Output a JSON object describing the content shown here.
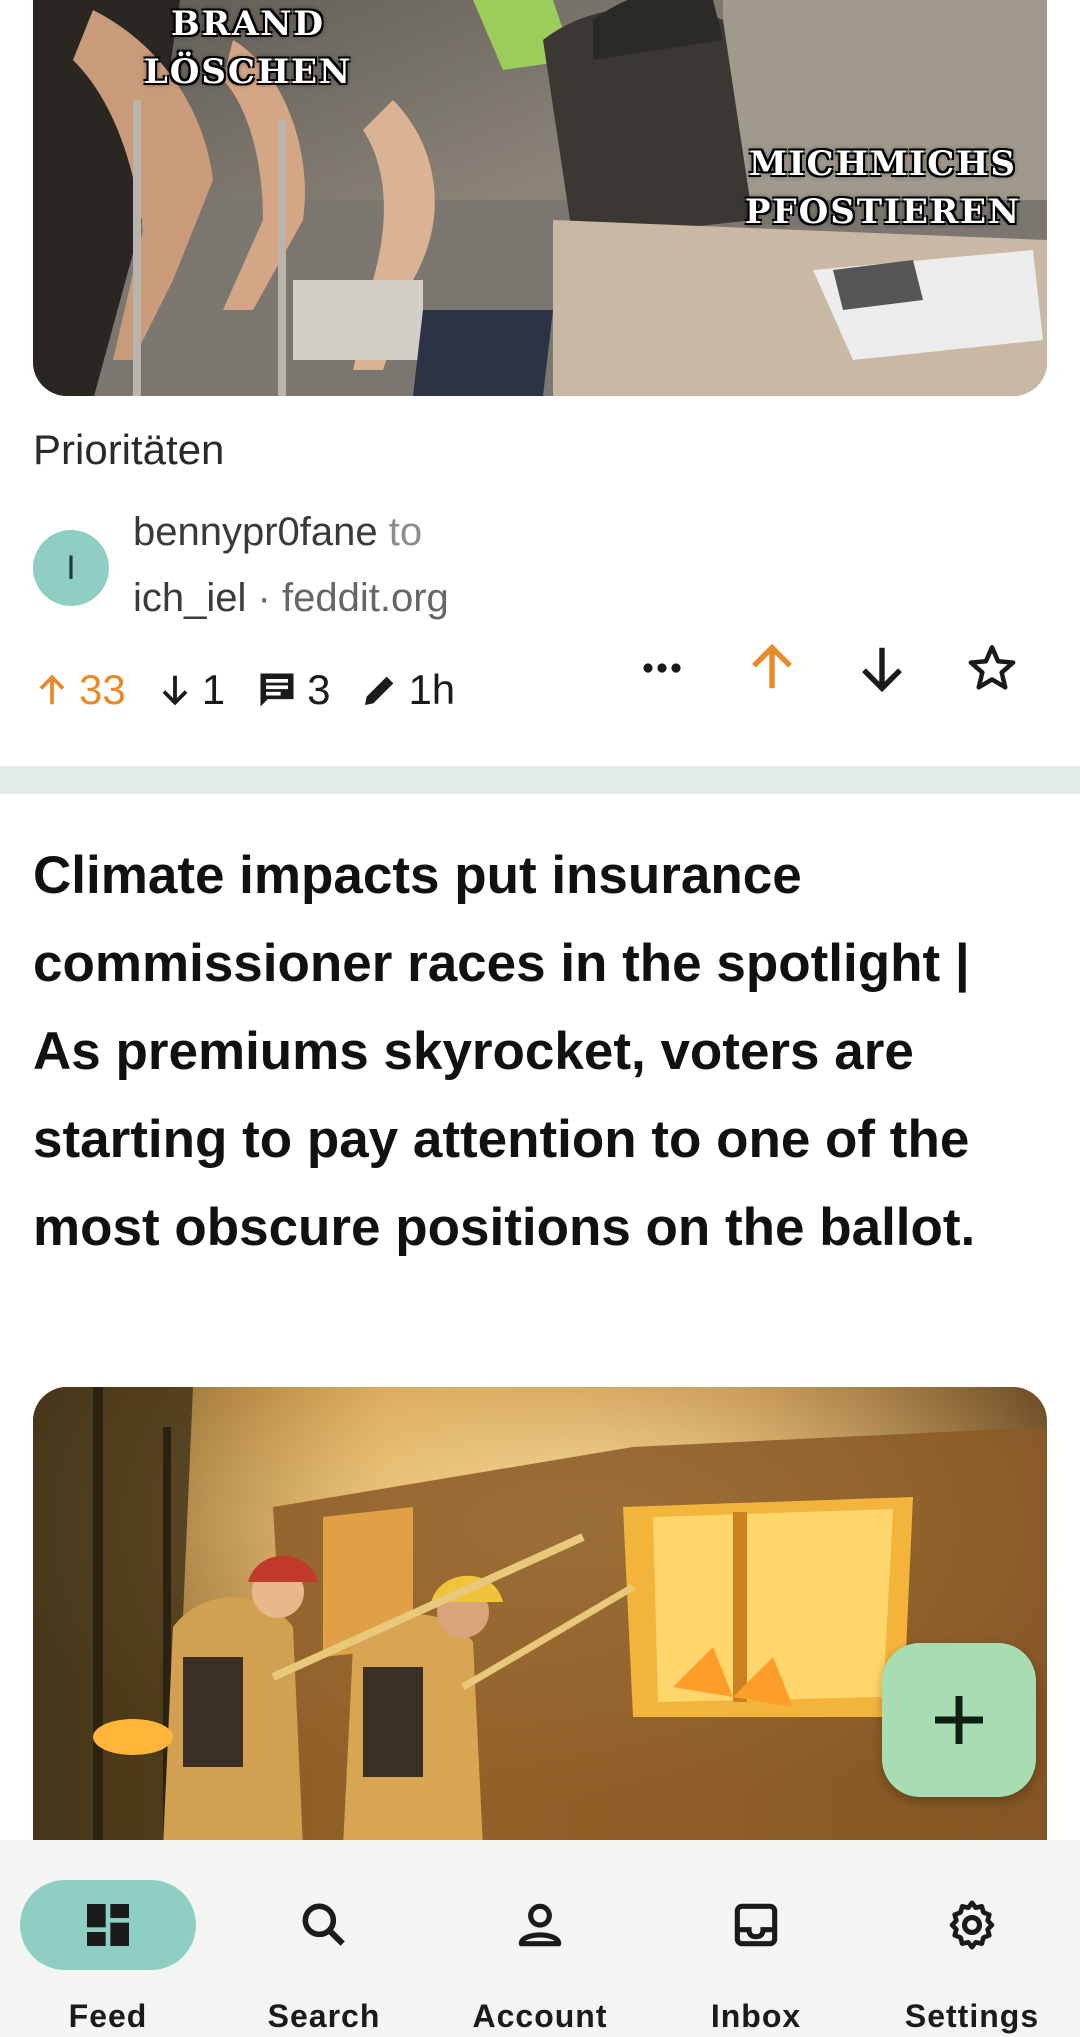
{
  "post1": {
    "image_overlay_left": [
      "BRAND",
      "LÖSCHEN"
    ],
    "image_overlay_right": [
      "MICHMICHS",
      "PFOSTIEREN"
    ],
    "title": "Prioritäten",
    "community_avatar_letter": "I",
    "author": "bennypr0fane",
    "to_label": "to",
    "community": "ich_iel",
    "separator": "·",
    "instance": "feddit.org",
    "upvotes": "33",
    "downvotes": "1",
    "comments": "3",
    "age": "1h",
    "icons": [
      "arrow-up-icon",
      "arrow-down-icon",
      "comment-icon",
      "pencil-icon",
      "more-horizontal-icon",
      "star-outline-icon"
    ]
  },
  "post2": {
    "title": "Climate impacts put insurance commissioner races in the spotlight | As premiums skyrocket, voters are starting to pay attention to one of the most obscure positions on the ballot."
  },
  "fab": {
    "icon": "plus-icon"
  },
  "nav": {
    "items": [
      {
        "label": "Feed",
        "icon": "dashboard-icon",
        "active": true
      },
      {
        "label": "Search",
        "icon": "search-icon",
        "active": false
      },
      {
        "label": "Account",
        "icon": "person-icon",
        "active": false
      },
      {
        "label": "Inbox",
        "icon": "inbox-icon",
        "active": false
      },
      {
        "label": "Settings",
        "icon": "gear-icon",
        "active": false
      }
    ]
  },
  "colors": {
    "accent": "#8fcfc3",
    "upvote": "#e88a2a",
    "fab": "#a8dcb3",
    "divider": "#e4ece7",
    "nav_background": "#f3f5f3"
  }
}
